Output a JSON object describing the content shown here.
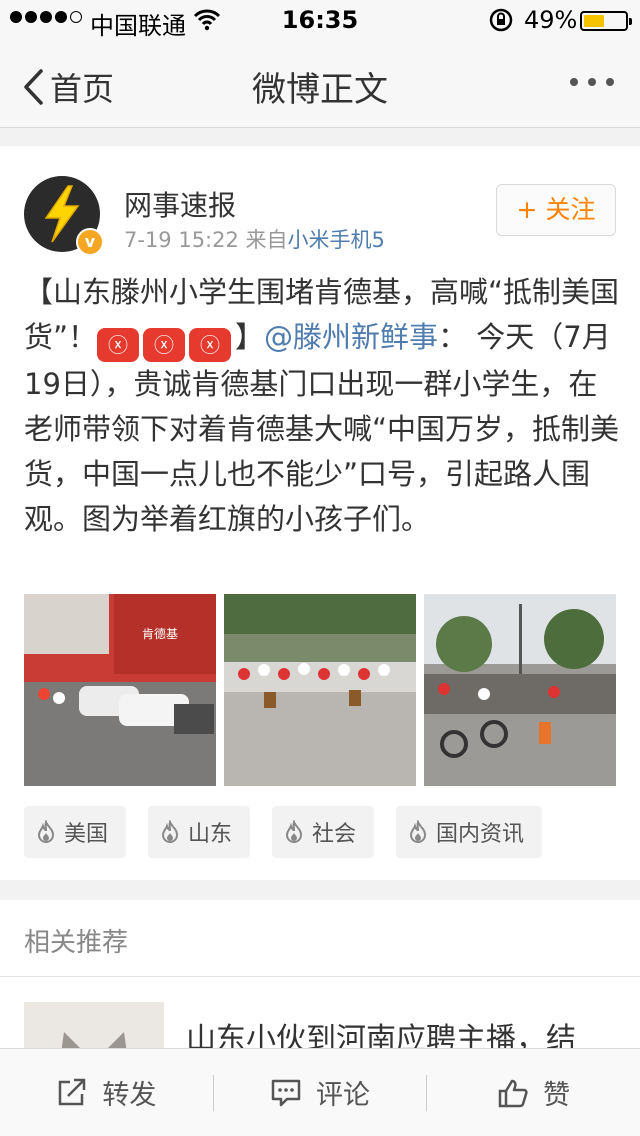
{
  "status_bar": {
    "carrier": "中国联通",
    "time": "16:35",
    "battery": "49%",
    "battery_level": 0.49,
    "icons": [
      "signal-dots-icon",
      "wifi-icon",
      "rotation-lock-icon",
      "battery-icon"
    ]
  },
  "nav": {
    "back_label": "首页",
    "title": "微博正文",
    "icons": [
      "chevron-left-icon",
      "more-icon"
    ]
  },
  "post": {
    "author": "网事速报",
    "timestamp": "7-19 15:22",
    "source_prefix": "来自",
    "source": "小米手机5",
    "follow_label": "+ 关注",
    "text_part1": "【山东滕州小学生围堵肯德基，高喊“抵制美国货”！",
    "emoji_label": "ⓧ",
    "text_part2": "】",
    "mention": "@滕州新鲜事",
    "text_part3": "： 今天（7月19日），贵诚肯德基门口出现一群小学生，在老师带领下对着肯德基大喊“中国万岁，抵制美货，中国一点儿也不能少”口号，引起路人围观。图为举着红旗的小孩子们。",
    "photo_sign": "肯德基",
    "tags": [
      "美国",
      "山东",
      "社会",
      "国内资讯"
    ]
  },
  "related": {
    "title": "相关推荐",
    "item_text": "山东小伙到河南应聘主播，结"
  },
  "toolbar": {
    "repost": "转发",
    "comment": "评论",
    "like": "赞"
  },
  "colors": {
    "link": "#507daf",
    "follow": "#ff8200",
    "badge": "#f5a623",
    "emoji": "#e63a2e",
    "battery": "#f6c300"
  }
}
